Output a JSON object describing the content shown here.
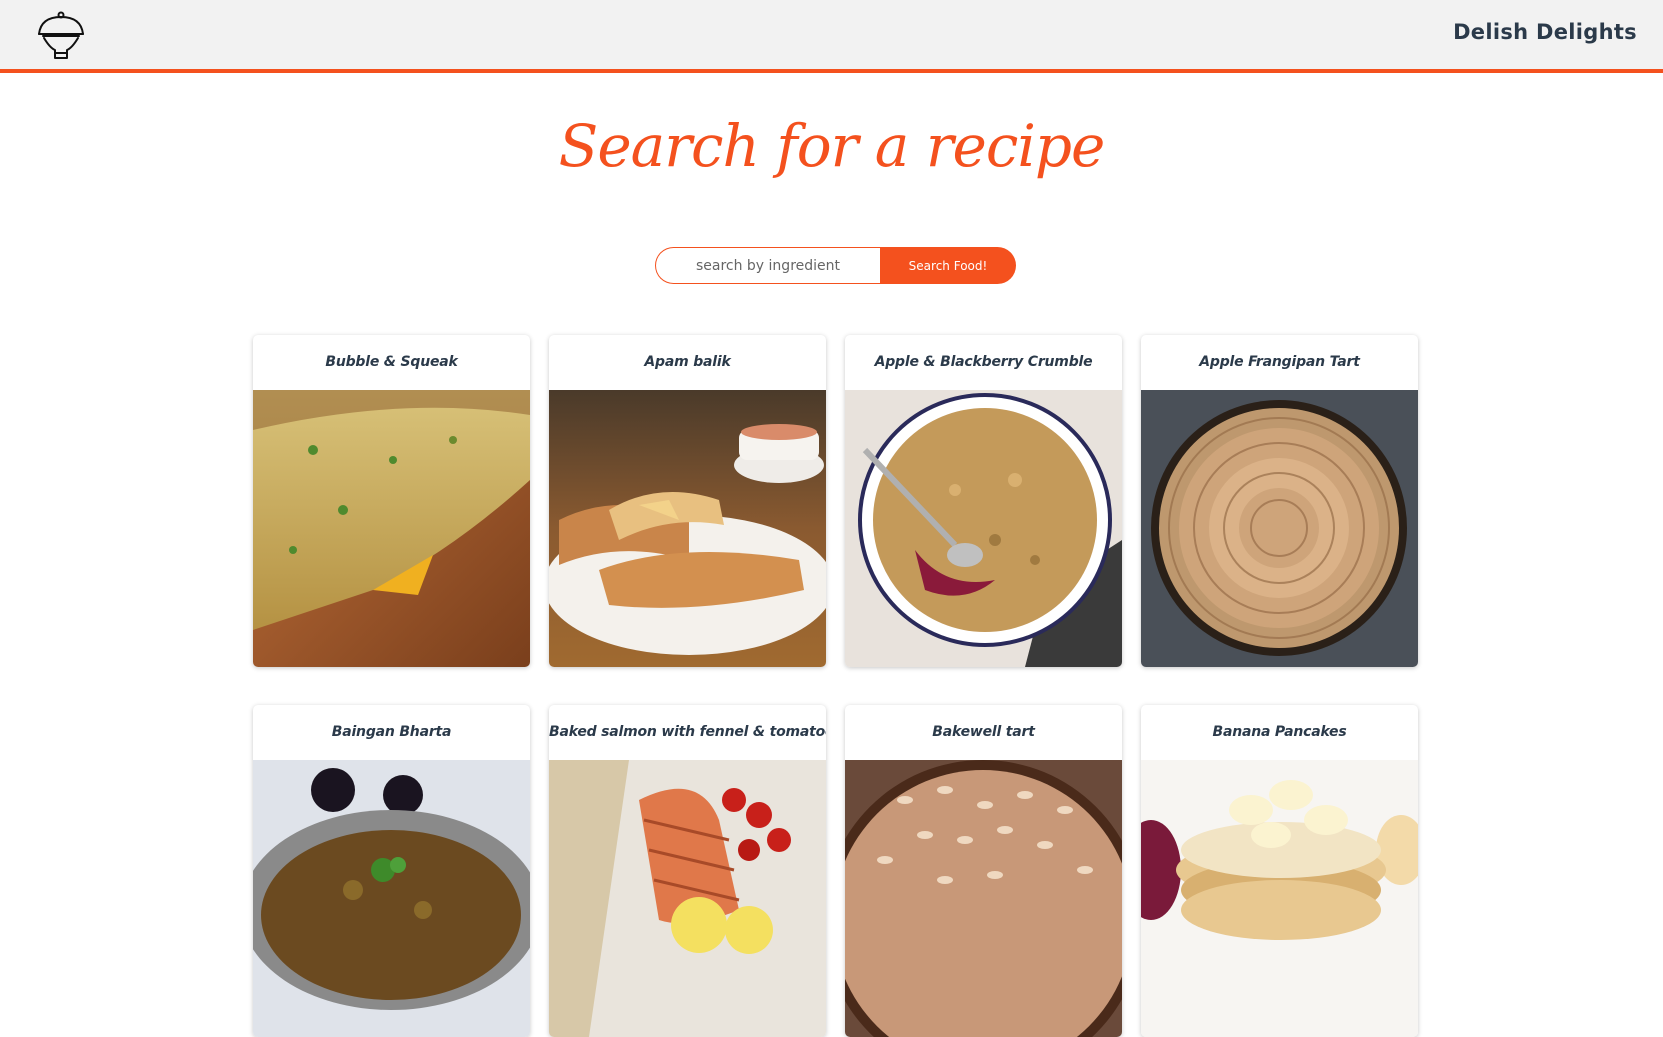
{
  "header": {
    "brand": "Delish Delights",
    "logo_icon": "cloche-icon"
  },
  "hero": {
    "title": "Search for a recipe"
  },
  "search": {
    "placeholder": "search by ingredient",
    "value": "",
    "button_label": "Search Food!"
  },
  "colors": {
    "accent": "#f4511e",
    "header_bg": "#f2f2f2",
    "text_dark": "#2b3a4a"
  },
  "recipes": [
    {
      "title": "Bubble & Squeak"
    },
    {
      "title": "Apam balik"
    },
    {
      "title": "Apple & Blackberry Crumble"
    },
    {
      "title": "Apple Frangipan Tart"
    },
    {
      "title": "Baingan Bharta"
    },
    {
      "title": "Baked salmon with fennel & tomatoes"
    },
    {
      "title": "Bakewell tart"
    },
    {
      "title": "Banana Pancakes"
    }
  ]
}
